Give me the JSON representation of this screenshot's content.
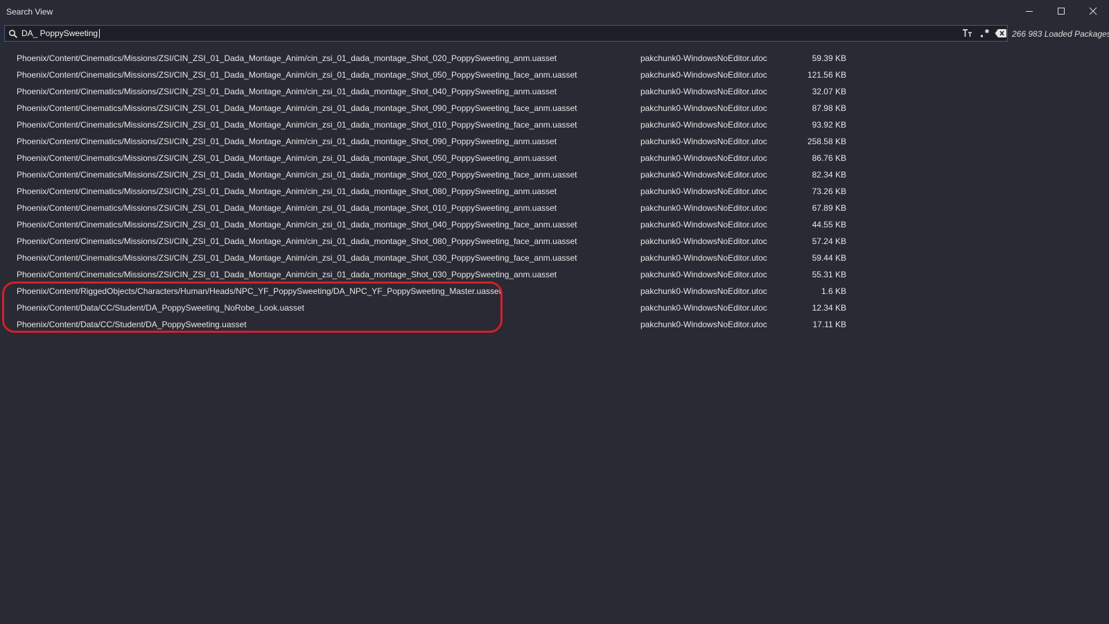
{
  "window": {
    "title": "Search View"
  },
  "search": {
    "value": "DA_ PoppySweeting",
    "loaded_packages": "266 983 Loaded Packages"
  },
  "results": [
    {
      "path": "Phoenix/Content/Cinematics/Missions/ZSI/CIN_ZSI_01_Dada_Montage_Anim/cin_zsi_01_dada_montage_Shot_020_PoppySweeting_anm.uasset",
      "archive": "pakchunk0-WindowsNoEditor.utoc",
      "size": "59.39 KB"
    },
    {
      "path": "Phoenix/Content/Cinematics/Missions/ZSI/CIN_ZSI_01_Dada_Montage_Anim/cin_zsi_01_dada_montage_Shot_050_PoppySweeting_face_anm.uasset",
      "archive": "pakchunk0-WindowsNoEditor.utoc",
      "size": "121.56 KB"
    },
    {
      "path": "Phoenix/Content/Cinematics/Missions/ZSI/CIN_ZSI_01_Dada_Montage_Anim/cin_zsi_01_dada_montage_Shot_040_PoppySweeting_anm.uasset",
      "archive": "pakchunk0-WindowsNoEditor.utoc",
      "size": "32.07 KB"
    },
    {
      "path": "Phoenix/Content/Cinematics/Missions/ZSI/CIN_ZSI_01_Dada_Montage_Anim/cin_zsi_01_dada_montage_Shot_090_PoppySweeting_face_anm.uasset",
      "archive": "pakchunk0-WindowsNoEditor.utoc",
      "size": "87.98 KB"
    },
    {
      "path": "Phoenix/Content/Cinematics/Missions/ZSI/CIN_ZSI_01_Dada_Montage_Anim/cin_zsi_01_dada_montage_Shot_010_PoppySweeting_face_anm.uasset",
      "archive": "pakchunk0-WindowsNoEditor.utoc",
      "size": "93.92 KB"
    },
    {
      "path": "Phoenix/Content/Cinematics/Missions/ZSI/CIN_ZSI_01_Dada_Montage_Anim/cin_zsi_01_dada_montage_Shot_090_PoppySweeting_anm.uasset",
      "archive": "pakchunk0-WindowsNoEditor.utoc",
      "size": "258.58 KB"
    },
    {
      "path": "Phoenix/Content/Cinematics/Missions/ZSI/CIN_ZSI_01_Dada_Montage_Anim/cin_zsi_01_dada_montage_Shot_050_PoppySweeting_anm.uasset",
      "archive": "pakchunk0-WindowsNoEditor.utoc",
      "size": "86.76 KB"
    },
    {
      "path": "Phoenix/Content/Cinematics/Missions/ZSI/CIN_ZSI_01_Dada_Montage_Anim/cin_zsi_01_dada_montage_Shot_020_PoppySweeting_face_anm.uasset",
      "archive": "pakchunk0-WindowsNoEditor.utoc",
      "size": "82.34 KB"
    },
    {
      "path": "Phoenix/Content/Cinematics/Missions/ZSI/CIN_ZSI_01_Dada_Montage_Anim/cin_zsi_01_dada_montage_Shot_080_PoppySweeting_anm.uasset",
      "archive": "pakchunk0-WindowsNoEditor.utoc",
      "size": "73.26 KB"
    },
    {
      "path": "Phoenix/Content/Cinematics/Missions/ZSI/CIN_ZSI_01_Dada_Montage_Anim/cin_zsi_01_dada_montage_Shot_010_PoppySweeting_anm.uasset",
      "archive": "pakchunk0-WindowsNoEditor.utoc",
      "size": "67.89 KB"
    },
    {
      "path": "Phoenix/Content/Cinematics/Missions/ZSI/CIN_ZSI_01_Dada_Montage_Anim/cin_zsi_01_dada_montage_Shot_040_PoppySweeting_face_anm.uasset",
      "archive": "pakchunk0-WindowsNoEditor.utoc",
      "size": "44.55 KB"
    },
    {
      "path": "Phoenix/Content/Cinematics/Missions/ZSI/CIN_ZSI_01_Dada_Montage_Anim/cin_zsi_01_dada_montage_Shot_080_PoppySweeting_face_anm.uasset",
      "archive": "pakchunk0-WindowsNoEditor.utoc",
      "size": "57.24 KB"
    },
    {
      "path": "Phoenix/Content/Cinematics/Missions/ZSI/CIN_ZSI_01_Dada_Montage_Anim/cin_zsi_01_dada_montage_Shot_030_PoppySweeting_face_anm.uasset",
      "archive": "pakchunk0-WindowsNoEditor.utoc",
      "size": "59.44 KB"
    },
    {
      "path": "Phoenix/Content/Cinematics/Missions/ZSI/CIN_ZSI_01_Dada_Montage_Anim/cin_zsi_01_dada_montage_Shot_030_PoppySweeting_anm.uasset",
      "archive": "pakchunk0-WindowsNoEditor.utoc",
      "size": "55.31 KB"
    },
    {
      "path": "Phoenix/Content/RiggedObjects/Characters/Human/Heads/NPC_YF_PoppySweeting/DA_NPC_YF_PoppySweeting_Master.uasset",
      "archive": "pakchunk0-WindowsNoEditor.utoc",
      "size": "1.6 KB"
    },
    {
      "path": "Phoenix/Content/Data/CC/Student/DA_PoppySweeting_NoRobe_Look.uasset",
      "archive": "pakchunk0-WindowsNoEditor.utoc",
      "size": "12.34 KB"
    },
    {
      "path": "Phoenix/Content/Data/CC/Student/DA_PoppySweeting.uasset",
      "archive": "pakchunk0-WindowsNoEditor.utoc",
      "size": "17.11 KB"
    }
  ],
  "icons": {
    "search": "search-icon",
    "match_case": "text-size-icon",
    "regex": "regex-icon",
    "clear": "backspace-icon",
    "minimize": "minimize-icon",
    "maximize": "maximize-icon",
    "close": "close-icon"
  },
  "colors": {
    "background": "#292a33",
    "search_border": "#3a5f8c",
    "highlight": "#d41f2c",
    "text": "#e8e8e8"
  }
}
